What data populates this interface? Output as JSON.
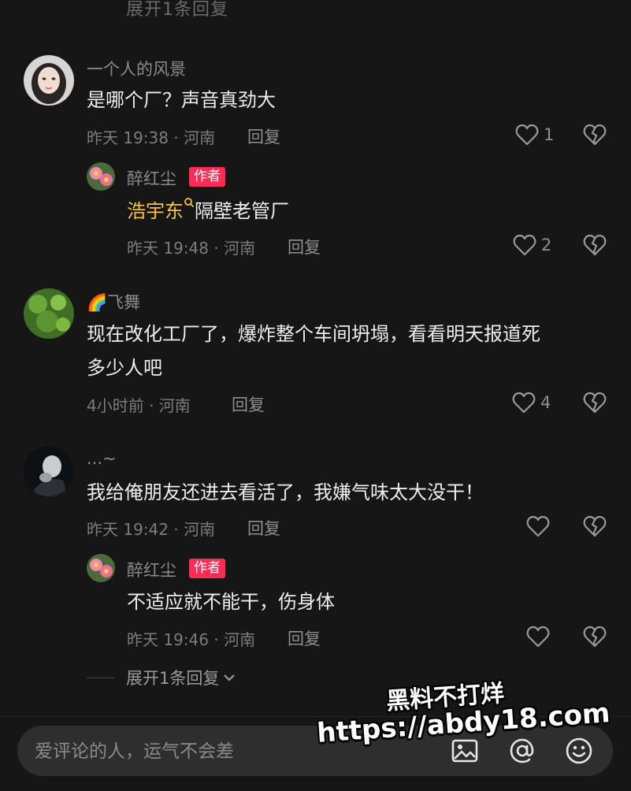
{
  "top_cut_text": "展开1条回复",
  "comments": [
    {
      "username": "一个人的风景",
      "text": "是哪个厂？声音真劲大",
      "meta": "昨天 19:38 · 河南",
      "reply_label": "回复",
      "likes": "1"
    },
    {
      "username": "醉红尘",
      "badge": "作者",
      "mention": "浩宇东",
      "text": "隔壁老管厂",
      "meta": "昨天 19:48 · 河南",
      "reply_label": "回复",
      "likes": "2"
    },
    {
      "username": "飞舞",
      "username_prefix_emoji": "🌈",
      "text_line1": "现在改化工厂了，爆炸整个车间坍塌，看看明天报道死",
      "text_line2": "多少人吧",
      "meta": "4小时前 · 河南",
      "reply_label": "回复",
      "likes": "4"
    },
    {
      "username": "...~",
      "text": "我给俺朋友还进去看活了，我嫌气味太大没干！",
      "meta": "昨天 19:42 · 河南",
      "reply_label": "回复",
      "likes": ""
    },
    {
      "username": "醉红尘",
      "badge": "作者",
      "text": "不适应就不能干，伤身体",
      "meta": "昨天 19:46 · 河南",
      "reply_label": "回复",
      "likes": ""
    }
  ],
  "expand_replies": "展开1条回复",
  "input": {
    "placeholder": "爱评论的人，运气不会差"
  },
  "watermark": {
    "line1": "黑料不打烊",
    "line2": "https://abdy18.com"
  },
  "icons": {
    "like": "heart-outline-icon",
    "dislike": "broken-heart-icon",
    "search": "search-icon",
    "image": "image-icon",
    "mention": "at-icon",
    "emoji": "emoji-icon",
    "chevron": "chevron-down-icon"
  },
  "colors": {
    "background": "#161616",
    "author_badge": "#fe2c55",
    "mention": "#f6c33b",
    "input_bg": "#2e2e2e"
  }
}
